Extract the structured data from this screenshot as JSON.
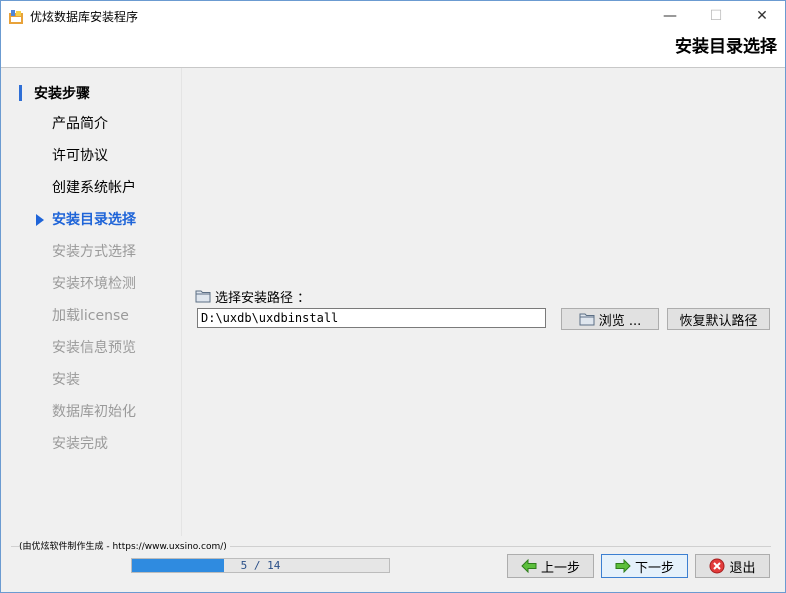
{
  "window": {
    "title": "优炫数据库安装程序",
    "page_heading": "安装目录选择",
    "minimize_icon": "—",
    "maximize_icon": "☐",
    "close_icon": "✕"
  },
  "sidebar": {
    "title": "安装步骤",
    "steps": [
      {
        "label": "产品简介",
        "state": "done"
      },
      {
        "label": "许可协议",
        "state": "done"
      },
      {
        "label": "创建系统帐户",
        "state": "done"
      },
      {
        "label": "安装目录选择",
        "state": "current"
      },
      {
        "label": "安装方式选择",
        "state": "pending"
      },
      {
        "label": "安装环境检测",
        "state": "pending"
      },
      {
        "label": "加载license",
        "state": "pending"
      },
      {
        "label": "安装信息预览",
        "state": "pending"
      },
      {
        "label": "安装",
        "state": "pending"
      },
      {
        "label": "数据库初始化",
        "state": "pending"
      },
      {
        "label": "安装完成",
        "state": "pending"
      }
    ]
  },
  "main": {
    "path_label": "选择安装路径 ：",
    "path_value": "D:\\uxdb\\uxdbinstall",
    "browse_label": "浏览 ...",
    "default_path_label": "恢复默认路径"
  },
  "footer": {
    "credit": "(由优炫软件制作生成 - https://www.uxsino.com/)",
    "progress_text": "5 / 14",
    "progress_fraction": 0.357,
    "prev_label": "上一步",
    "next_label": "下一步",
    "exit_label": "退出"
  },
  "colors": {
    "accent": "#1e64d8",
    "progress": "#2f8be0",
    "pending_text": "#9a9a9a"
  }
}
